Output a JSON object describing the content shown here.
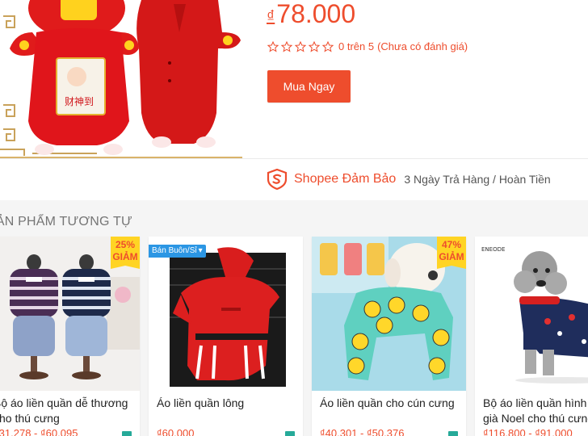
{
  "product": {
    "price_currency": "₫",
    "price_value": "78.000",
    "rating_text": "0 trên 5",
    "rating_note": "(Chưa có đánh giá)",
    "stars": 0,
    "buy_label": "Mua Ngay",
    "guarantee_title": "Shopee Đảm Bảo",
    "guarantee_detail": "3 Ngày Trả Hàng / Hoàn Tiền"
  },
  "similar": {
    "title": "SẢN PHẨM TƯƠNG TỰ",
    "items": [
      {
        "name": "Bộ áo liền quần dễ thương cho thú cưng",
        "price": "₫31.278 - ₫60.095",
        "discount": "25% GIẢM",
        "badge": ""
      },
      {
        "name": "Áo liền quần lông",
        "price": "₫60.000",
        "discount": "",
        "badge": "Bán Buôn/Sỉ"
      },
      {
        "name": "Áo liền quần cho cún cưng",
        "price": "₫40.301 - ₫50.376",
        "discount": "47% GIẢM",
        "badge": ""
      },
      {
        "name": "Bộ áo liền quần hình ông già Noel cho thú cưng",
        "price": "₫116.800 - ₫91.000",
        "discount": "",
        "badge": ""
      }
    ]
  },
  "colors": {
    "accent": "#ee4d2d",
    "discount_bg": "#ffd424",
    "wholesale_bg": "#2b96e4"
  }
}
